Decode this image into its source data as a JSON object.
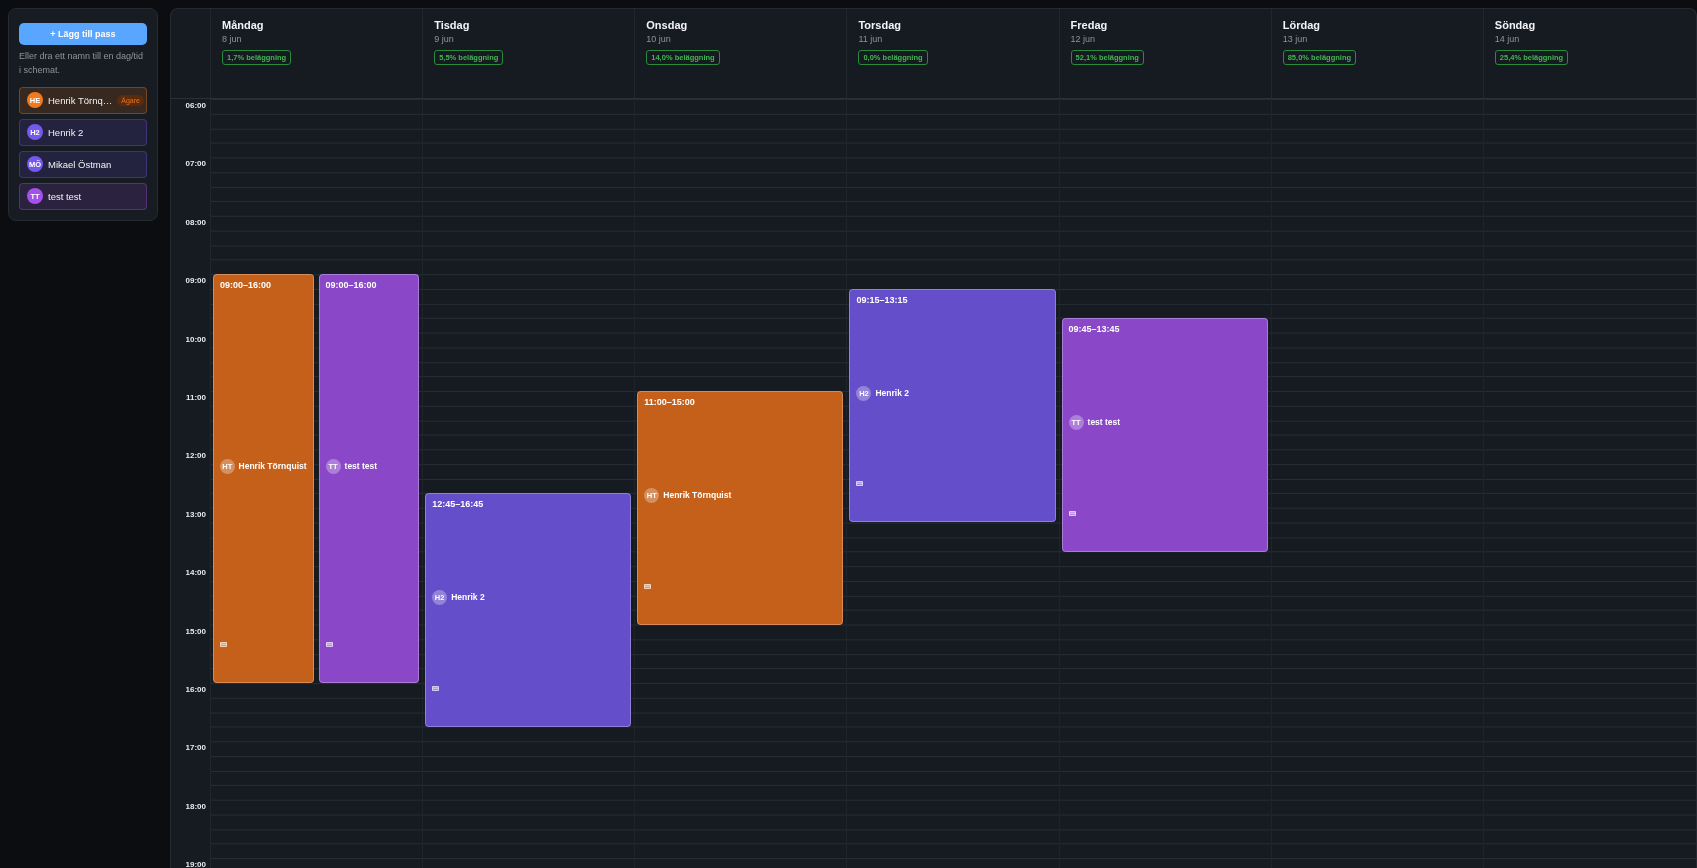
{
  "sidebar": {
    "add_button": "+ Lägg till pass",
    "hint": "Eller dra ett namn till en dag/tid i schemat.",
    "people": [
      {
        "initials": "HE",
        "name": "Henrik Törnq…",
        "badge": "Ägare",
        "color": "#f27a1e"
      },
      {
        "initials": "H2",
        "name": "Henrik 2",
        "color": "#7558ee"
      },
      {
        "initials": "MÖ",
        "name": "Mikael Östman",
        "color": "#7558ee"
      },
      {
        "initials": "TT",
        "name": "test test",
        "color": "#a451ec"
      }
    ]
  },
  "calendar": {
    "hours": [
      "06:00",
      "07:00",
      "08:00",
      "09:00",
      "10:00",
      "11:00",
      "12:00",
      "13:00",
      "14:00",
      "15:00",
      "16:00",
      "17:00",
      "18:00",
      "19:00"
    ],
    "days": [
      {
        "name": "Måndag",
        "date": "8 jun",
        "occupancy": "1,7% beläggning",
        "events": [
          {
            "time": "09:00–16:00",
            "initials": "HT",
            "person": "Henrik Törnquist",
            "color": "#c5601a"
          },
          {
            "time": "09:00–16:00",
            "initials": "TT",
            "person": "test test",
            "color": "#8a48c8"
          }
        ]
      },
      {
        "name": "Tisdag",
        "date": "9 jun",
        "occupancy": "5,5% beläggning",
        "events": [
          {
            "time": "12:45–16:45",
            "initials": "H2",
            "person": "Henrik 2",
            "color": "#654ec9"
          }
        ]
      },
      {
        "name": "Onsdag",
        "date": "10 jun",
        "occupancy": "14,0% beläggning",
        "events": [
          {
            "time": "11:00–15:00",
            "initials": "HT",
            "person": "Henrik Törnquist",
            "color": "#c5601a"
          }
        ]
      },
      {
        "name": "Torsdag",
        "date": "11 jun",
        "occupancy": "0,0% beläggning",
        "events": [
          {
            "time": "09:15–13:15",
            "initials": "H2",
            "person": "Henrik 2",
            "color": "#654ec9"
          }
        ]
      },
      {
        "name": "Fredag",
        "date": "12 jun",
        "occupancy": "52,1% beläggning",
        "events": [
          {
            "time": "09:45–13:45",
            "initials": "TT",
            "person": "test test",
            "color": "#8a48c8"
          }
        ]
      },
      {
        "name": "Lördag",
        "date": "13 jun",
        "occupancy": "85,0% beläggning"
      },
      {
        "name": "Söndag",
        "date": "14 jun",
        "occupancy": "25,4% beläggning"
      }
    ]
  }
}
